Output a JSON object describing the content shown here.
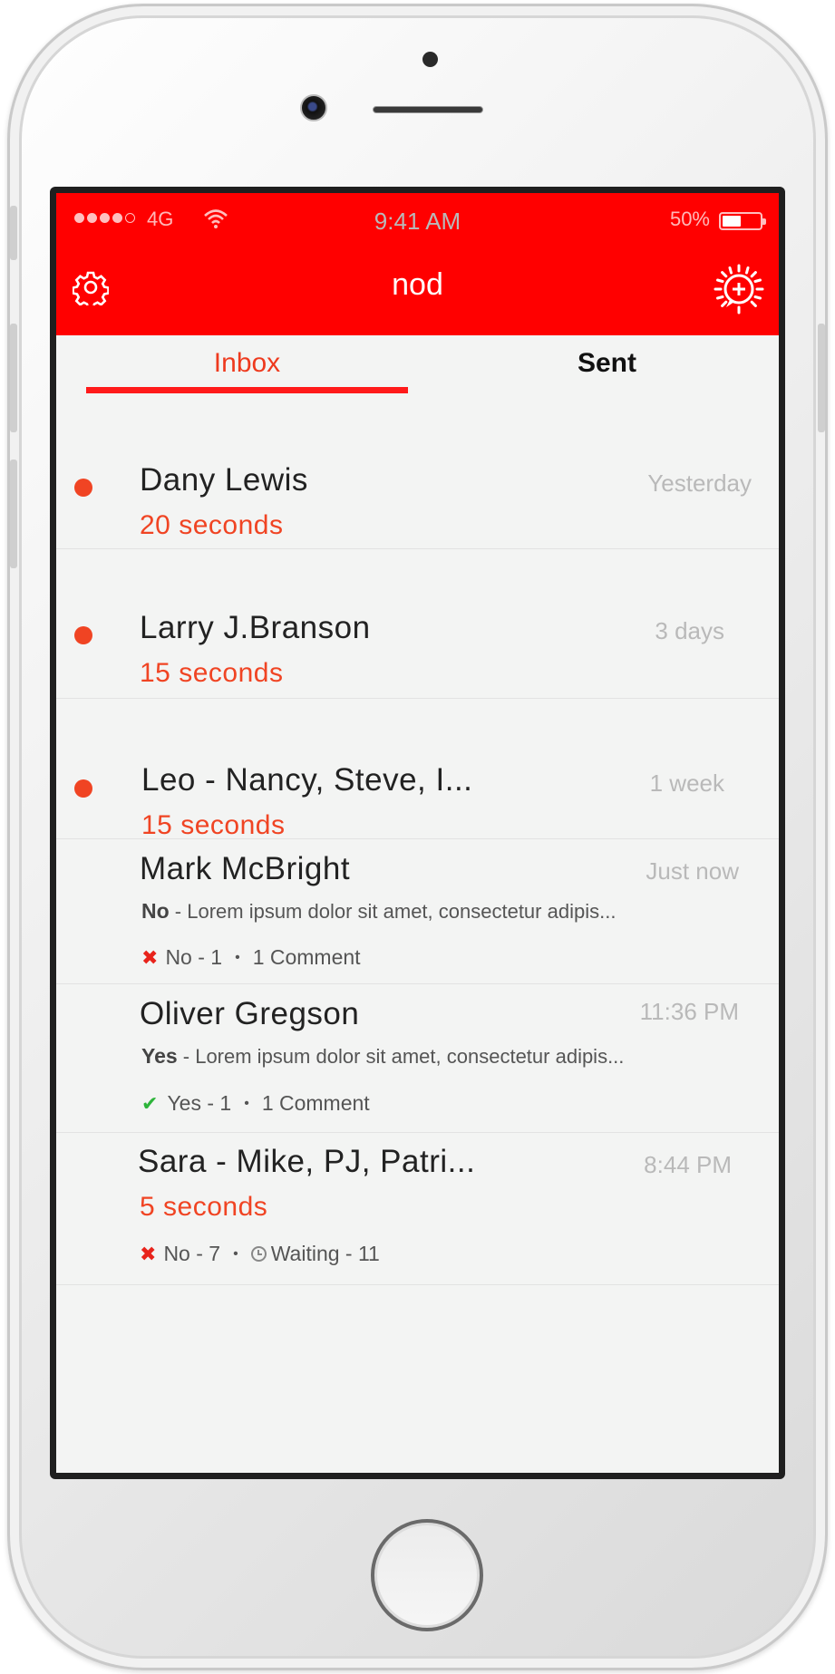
{
  "status_bar": {
    "network": "4G",
    "time": "9:41 AM",
    "battery_text": "50%",
    "battery_level": 0.5
  },
  "nav": {
    "title": "nod",
    "left_icon": "gear-icon",
    "right_icon": "compose-plus-icon"
  },
  "tabs": {
    "inbox": "Inbox",
    "sent": "Sent",
    "active": "inbox"
  },
  "colors": {
    "brand_red": "#ff0000",
    "accent_orange": "#f04423",
    "yes_green": "#2db43a",
    "no_red": "#e8231b"
  },
  "messages": [
    {
      "name": "Dany Lewis",
      "time": "Yesterday",
      "duration": "20 seconds",
      "unread": true
    },
    {
      "name": "Larry J.Branson",
      "time": "3 days",
      "duration": "15 seconds",
      "unread": true
    },
    {
      "name": "Leo - Nancy, Steve, I...",
      "time": "1 week",
      "duration": "15 seconds",
      "unread": true
    },
    {
      "name": "Mark McBright",
      "time": "Just now",
      "preview_answer": "No",
      "preview_text": " - Lorem ipsum dolor sit amet, consectetur adipis...",
      "meta_answer": "No - 1",
      "meta_extra": "1 Comment"
    },
    {
      "name": "Oliver Gregson",
      "time": "11:36 PM",
      "preview_answer": "Yes",
      "preview_text": " - Lorem ipsum dolor sit amet, consectetur adipis...",
      "meta_answer": "Yes - 1",
      "meta_extra": "1 Comment"
    },
    {
      "name": "Sara - Mike, PJ, Patri...",
      "time": "8:44 PM",
      "duration": "5 seconds",
      "meta_answer": "No - 7",
      "meta_extra": "Waiting - 11"
    }
  ]
}
